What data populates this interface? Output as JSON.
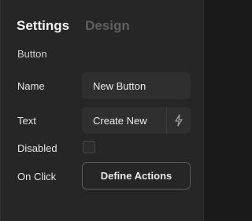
{
  "tabs": {
    "settings": "Settings",
    "design": "Design"
  },
  "section": {
    "title": "Button"
  },
  "fields": {
    "name": {
      "label": "Name",
      "value": "New Button"
    },
    "text": {
      "label": "Text",
      "value": "Create New",
      "action_icon": "lightning-bolt-icon"
    },
    "disabled": {
      "label": "Disabled",
      "checked": false
    },
    "on_click": {
      "label": "On Click",
      "button_label": "Define Actions"
    }
  }
}
